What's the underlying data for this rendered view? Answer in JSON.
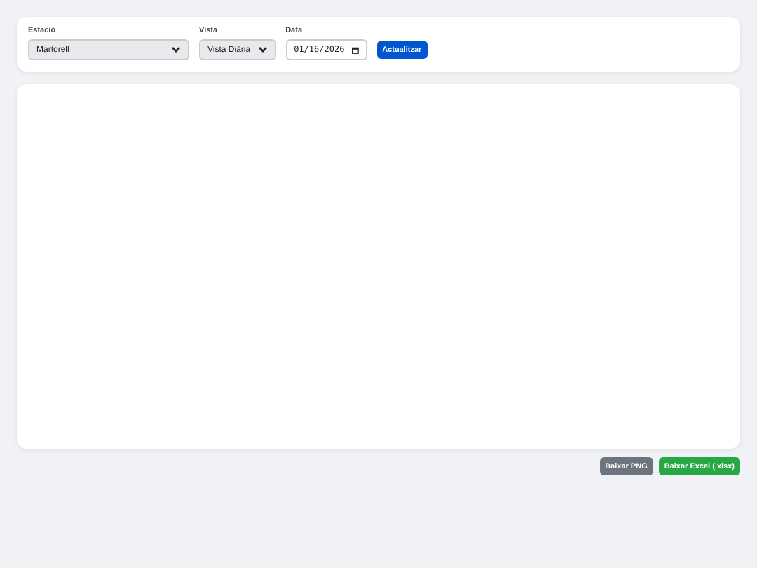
{
  "filters": [
    {
      "kind": "select",
      "label": "Estació",
      "value": "Martorell"
    },
    {
      "kind": "select",
      "label": "Vista",
      "value": "Vista Diària"
    },
    {
      "kind": "date",
      "label": "Data",
      "value": "01/16/2026"
    }
  ],
  "refresh_button": "Actualitzar",
  "actions": [
    {
      "label": "Baixar PNG",
      "kind": "secondary"
    },
    {
      "label": "Baixar Excel (.xlsx)",
      "kind": "success"
    }
  ]
}
